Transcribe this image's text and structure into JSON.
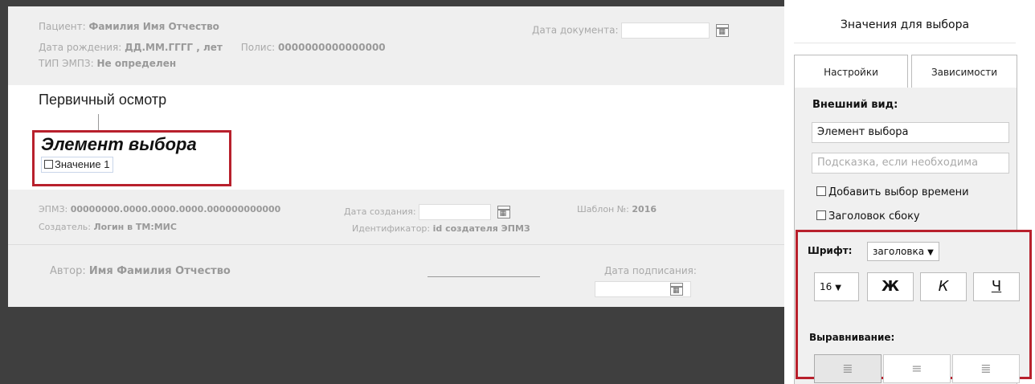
{
  "document": {
    "patient_label": "Пациент:",
    "patient_value": "Фамилия Имя Отчество",
    "dob_label": "Дата рождения:",
    "dob_value": "ДД.ММ.ГГГГ , лет",
    "policy_label": "Полис:",
    "policy_value": "0000000000000000",
    "emrtype_label": "ТИП ЭМПЗ:",
    "emrtype_value": "Не определен",
    "docdate_label": "Дата документа:",
    "section_title": "Первичный осмотр",
    "choice_title": "Элемент выбора",
    "choice_option": "Значение 1",
    "emz_label": "ЭПМЗ:",
    "emz_value": "00000000.0000.0000.0000.000000000000",
    "creator_label": "Создатель:",
    "creator_value": "Логин в ТМ:МИС",
    "created_label": "Дата создания:",
    "identifier_label": "Идентификатор:",
    "identifier_value": "id создателя ЭПМЗ",
    "template_label": "Шаблон №:",
    "template_value": "2016",
    "author_label": "Автор:",
    "author_value": "Имя Фамилия Отчество",
    "signdate_label": "Дата подписания:"
  },
  "panel": {
    "title": "Значения для выбора",
    "tabs": [
      "Настройки",
      "Зависимости"
    ],
    "appearance_label": "Внешний вид:",
    "title_field_value": "Элемент выбора",
    "hint_placeholder": "Подсказка, если необходима",
    "add_time_label": "Добавить выбор времени",
    "side_header_label": "Заголовок сбоку",
    "font_label": "Шрифт:",
    "font_value": "заголовка",
    "size_value": "16",
    "bold_label": "Ж",
    "italic_label": "К",
    "underline_label": "Ч",
    "align_label": "Выравнивание:"
  },
  "icons": {
    "calendar": "calendar-icon",
    "align_left": "align-left-icon",
    "align_center": "align-center-icon",
    "align_right": "align-right-icon"
  },
  "colors": {
    "highlight": "#b8202c",
    "dark_bg": "#3f3f3f"
  }
}
